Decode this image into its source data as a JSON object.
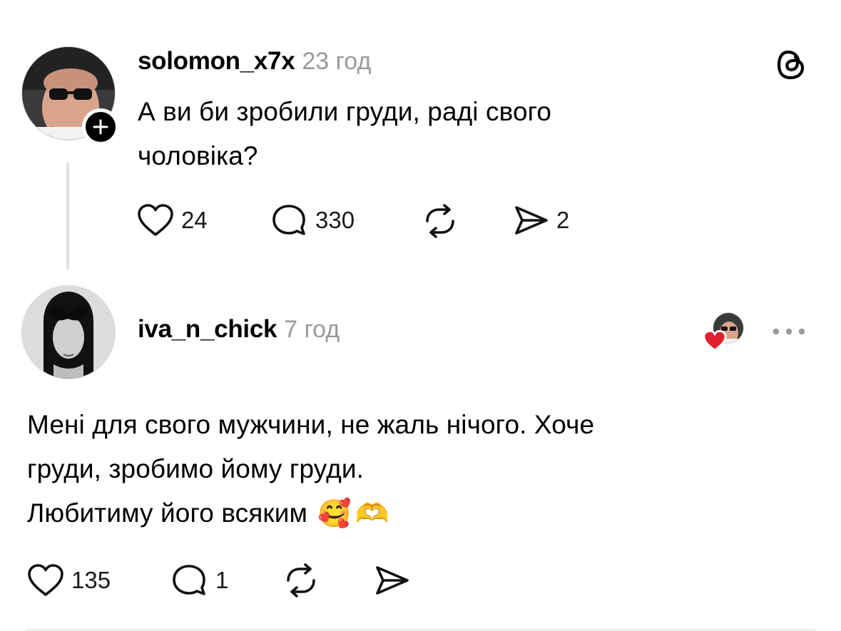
{
  "post": {
    "username": "solomon_x7x",
    "time": "23 год",
    "text_line1": "А ви би зробили груди, раді свого",
    "text_line2": "чоловіка?",
    "likes": "24",
    "replies": "330",
    "shares": "2",
    "app_icon": "threads-logo-icon"
  },
  "reply": {
    "username": "iva_n_chick",
    "time": "7 год",
    "text_line1": "Мені для свого мужчини, не жаль нічого. Хоче",
    "text_line2": "груди, зробимо йому груди.",
    "text_line3": "Любитиму його всяким",
    "emoji1": "🥰",
    "emoji2": "🫶",
    "likes": "135",
    "replies": "1",
    "liked_by_author": true
  },
  "colors": {
    "text": "#000000",
    "muted": "#9a9a9a",
    "heart": "#e0202f",
    "divider": "#e6e6e6"
  }
}
